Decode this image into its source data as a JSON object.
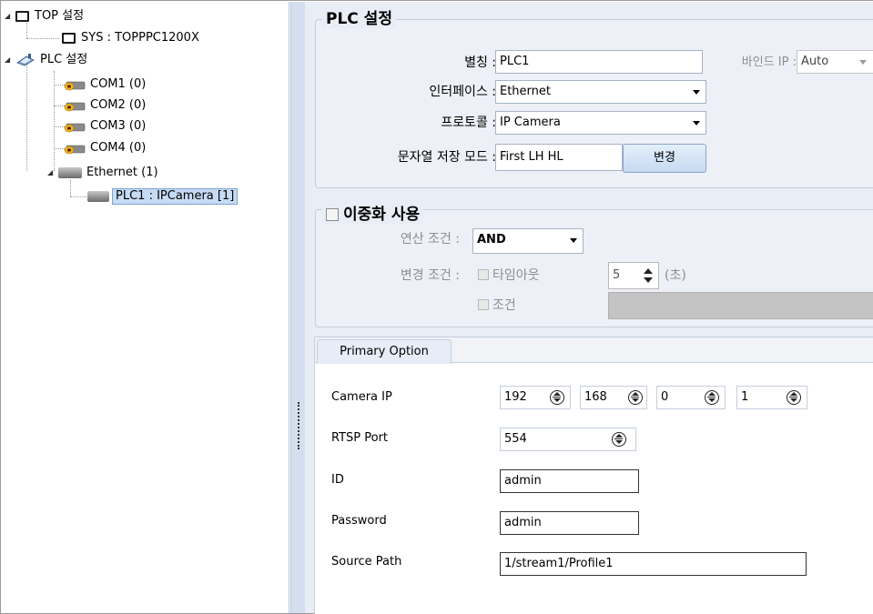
{
  "tree": {
    "top_settings": "TOP 설정",
    "sys": "SYS : TOPPPC1200X",
    "plc_settings": "PLC 설정",
    "com1": "COM1 (0)",
    "com2": "COM2 (0)",
    "com3": "COM3 (0)",
    "com4": "COM4 (0)",
    "ethernet": "Ethernet (1)",
    "plc1": "PLC1 : IPCamera [1]",
    "expanded_glyph": "◢"
  },
  "plc_group": {
    "title": "PLC 설정",
    "alias_label": "별칭 :",
    "alias_value": "PLC1",
    "bind_ip_label": "바인드 IP :",
    "bind_ip_value": "Auto",
    "interface_label": "인터페이스 :",
    "interface_value": "Ethernet",
    "protocol_label": "프로토콜 :",
    "protocol_value": "IP Camera",
    "string_mode_label": "문자열 저장 모드 :",
    "string_mode_value": "First LH HL",
    "change_button": "변경"
  },
  "redundancy": {
    "title": "이중화 사용",
    "op_condition_label": "연산 조건 :",
    "op_condition_value": "AND",
    "change_condition_label": "변경 조건 :",
    "timeout_label": "타임아웃",
    "timeout_value": "5",
    "timeout_unit": "(초)",
    "condition_label": "조건"
  },
  "tabs": {
    "primary": "Primary Option"
  },
  "primary": {
    "camera_ip_label": "Camera IP",
    "ip1": "192",
    "ip2": "168",
    "ip3": "0",
    "ip4": "1",
    "rtsp_port_label": "RTSP Port",
    "rtsp_port_value": "554",
    "id_label": "ID",
    "id_value": "admin",
    "password_label": "Password",
    "password_value": "admin",
    "source_path_label": "Source Path",
    "source_path_value": "1/stream1/Profile1"
  },
  "colors": {
    "panel_bg": "#e9edf5",
    "splitter": "#d3dfee",
    "selection": "#c6dbf5",
    "button": "#c6daf1"
  }
}
